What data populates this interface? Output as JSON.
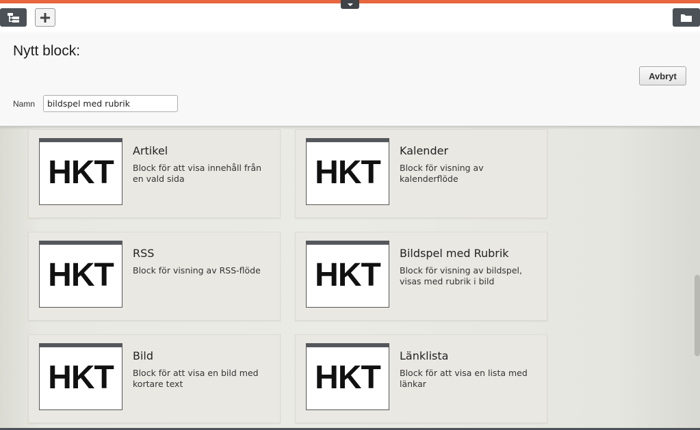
{
  "header": {
    "title": "Nytt block:",
    "cancel_label": "Avbryt",
    "name_label": "Namn",
    "name_value": "bildspel med rubrik"
  },
  "toolbar": {
    "tree_icon": "page-tree-icon",
    "add_icon": "plus-icon",
    "folder_icon": "folder-icon",
    "toggle_icon": "caret-down-icon"
  },
  "colors": {
    "accent": "#e8663d",
    "dark_button": "#4b5157"
  },
  "blocks": [
    {
      "thumb_text": "HKT",
      "title": "Artikel",
      "description": "Block för att visa innehåll från en vald sida"
    },
    {
      "thumb_text": "HKT",
      "title": "Kalender",
      "description": "Block för visning av kalenderflöde"
    },
    {
      "thumb_text": "HKT",
      "title": "RSS",
      "description": "Block för visning av RSS-flöde"
    },
    {
      "thumb_text": "HKT",
      "title": "Bildspel med Rubrik",
      "description": "Block för visning av bildspel, visas med rubrik i bild"
    },
    {
      "thumb_text": "HKT",
      "title": "Bild",
      "description": "Block för att visa en bild med kortare text"
    },
    {
      "thumb_text": "HKT",
      "title": "Länklista",
      "description": "Block för att visa en lista med länkar"
    }
  ]
}
